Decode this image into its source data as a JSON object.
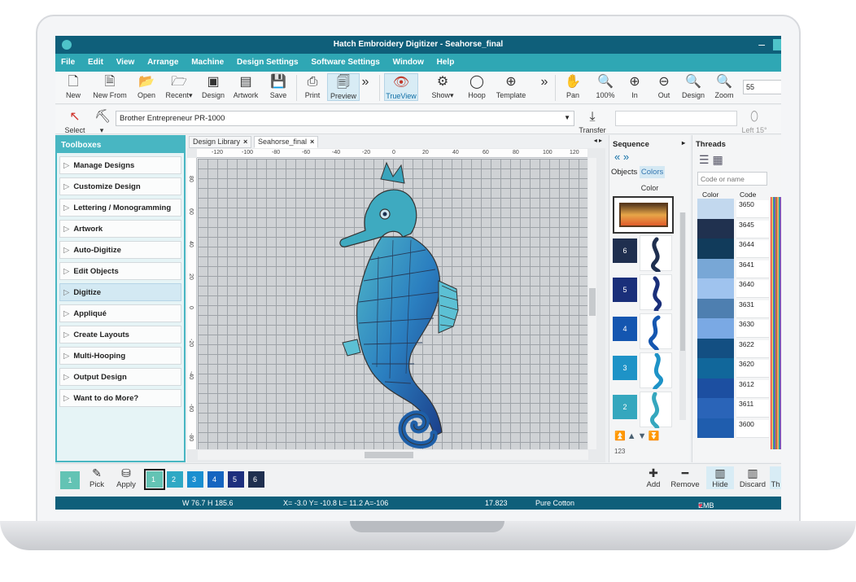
{
  "window": {
    "title": "Hatch Embroidery Digitizer - Seahorse_final"
  },
  "menu": [
    "File",
    "Edit",
    "View",
    "Arrange",
    "Machine",
    "Design Settings",
    "Software Settings",
    "Window",
    "Help"
  ],
  "toolbar": {
    "new": "New",
    "new_from": "New From",
    "open": "Open",
    "recent": "Recent",
    "design": "Design",
    "artwork": "Artwork",
    "save": "Save",
    "print": "Print",
    "preview": "Preview",
    "trueview": "TrueView",
    "show": "Show",
    "hoop": "Hoop",
    "template": "Template",
    "pan": "Pan",
    "zoom100": "100%",
    "zoom_in": "In",
    "zoom_out": "Out",
    "zoom_design": "Design",
    "zoom": "Zoom",
    "zoom_value": "55"
  },
  "selectrow": {
    "select": "Select",
    "machine": "Brother Entrepreneur PR-1000",
    "transfer": "Transfer",
    "left": "Left 15°"
  },
  "toolboxes": {
    "title": "Toolboxes",
    "items": [
      "Manage Designs",
      "Customize Design",
      "Lettering / Monogramming",
      "Artwork",
      "Auto-Digitize",
      "Edit Objects",
      "Digitize",
      "Appliqué",
      "Create Layouts",
      "Multi-Hooping",
      "Output Design",
      "Want to do More?"
    ],
    "active": "Digitize"
  },
  "doc": {
    "tabs": [
      "Design Library",
      "Seahorse_final"
    ],
    "ruler_h": [
      "-120",
      "-100",
      "-80",
      "-60",
      "-40",
      "-20",
      "0",
      "20",
      "40",
      "60",
      "80",
      "100",
      "120"
    ],
    "ruler_v": [
      "80",
      "60",
      "40",
      "20",
      "0",
      "-20",
      "-40",
      "-60",
      "-80"
    ]
  },
  "sequence": {
    "title": "Sequence",
    "tab_objects": "Objects",
    "tab_colors": "Colors",
    "col_label": "Color",
    "swatches": [
      {
        "num": "6",
        "color": "#1f2f4f"
      },
      {
        "num": "5",
        "color": "#1a2f7a"
      },
      {
        "num": "4",
        "color": "#1456b0"
      },
      {
        "num": "3",
        "color": "#1e93c7"
      },
      {
        "num": "2",
        "color": "#35a7be"
      }
    ]
  },
  "threads": {
    "title": "Threads",
    "search_placeholder": "Code or name",
    "col_color": "Color",
    "col_code": "Code",
    "rows": [
      {
        "code": "3650",
        "color": "#c2d8ee"
      },
      {
        "code": "3645",
        "color": "#20314f"
      },
      {
        "code": "3644",
        "color": "#113b5b"
      },
      {
        "code": "3641",
        "color": "#78a7d6"
      },
      {
        "code": "3640",
        "color": "#9fc3ee"
      },
      {
        "code": "3631",
        "color": "#4e7fb0"
      },
      {
        "code": "3630",
        "color": "#7aa9e4"
      },
      {
        "code": "3622",
        "color": "#134f82"
      },
      {
        "code": "3620",
        "color": "#11679b"
      },
      {
        "code": "3612",
        "color": "#1c4fa1"
      },
      {
        "code": "3611",
        "color": "#2a64b8"
      },
      {
        "code": "3600",
        "color": "#1f5dae"
      }
    ]
  },
  "bottom": {
    "current": "1",
    "pick": "Pick",
    "apply": "Apply",
    "chips": [
      {
        "num": "1",
        "color": "#63c3b4"
      },
      {
        "num": "2",
        "color": "#2fa8c4"
      },
      {
        "num": "3",
        "color": "#1a8fd0"
      },
      {
        "num": "4",
        "color": "#1565c0"
      },
      {
        "num": "5",
        "color": "#1d2f7e"
      },
      {
        "num": "6",
        "color": "#1f2f4f"
      }
    ],
    "add": "Add",
    "remove": "Remove",
    "hide": "Hide",
    "discard": "Discard",
    "th": "Th"
  },
  "status": {
    "size": "W  76.7  H 185.6",
    "coords": "X=  -3.0 Y= -10.8 L=  11.2 A=-106",
    "value": "17.823",
    "fabric": "Pure Cotton",
    "grade": "EMB Grade: A"
  },
  "colors": {
    "titlebar": "#0f5f7a",
    "menubar": "#2fa7b4",
    "toolbox_border": "#48b6c2"
  }
}
